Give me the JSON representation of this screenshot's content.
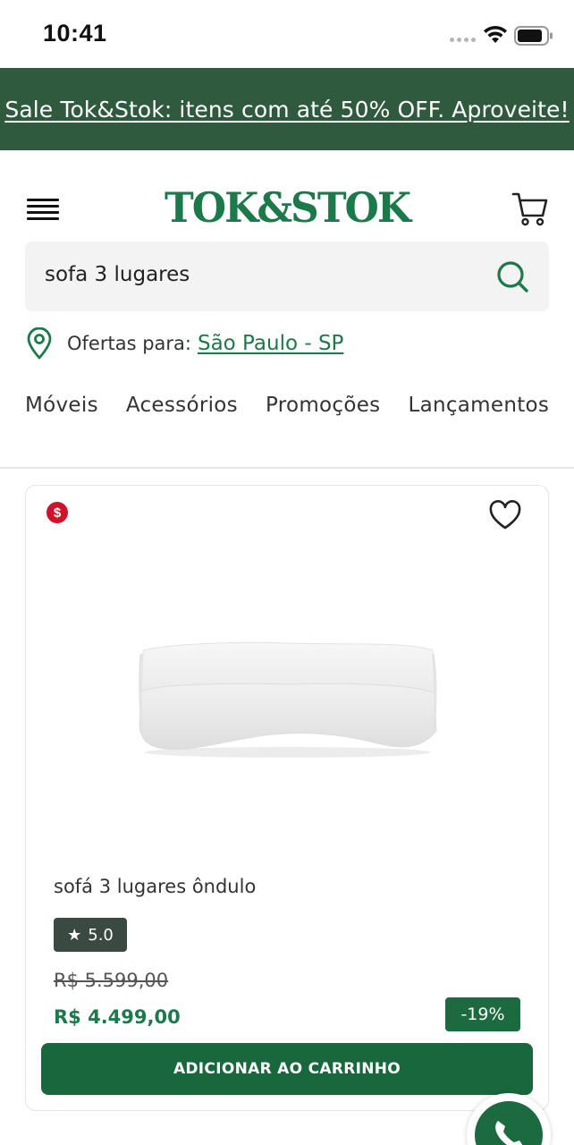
{
  "status_bar": {
    "time": "10:41"
  },
  "promo_banner": {
    "text": "Sale Tok&Stok: itens com até 50% OFF. Aproveite!"
  },
  "header": {
    "logo": "TOK&STOK"
  },
  "search": {
    "value": "sofa 3 lugares"
  },
  "location": {
    "label": "Ofertas para:",
    "city": "São Paulo - SP"
  },
  "categories": [
    "Móveis",
    "Acessórios",
    "Promoções",
    "Lançamentos"
  ],
  "product": {
    "sale_badge": "$",
    "name": "sofá 3 lugares ôndulo",
    "rating": "5.0",
    "old_price": "R$ 5.599,00",
    "price": "R$ 4.499,00",
    "discount": "-19%",
    "add_to_cart_label": "ADICIONAR AO CARRINHO"
  },
  "colors": {
    "brand_green": "#1c7a4a",
    "banner_green": "#2f5a3e",
    "button_green": "#19673d",
    "sale_red": "#d0122b"
  },
  "icons": [
    "wifi-icon",
    "battery-icon",
    "menu-icon",
    "cart-icon",
    "search-icon",
    "pin-icon",
    "heart-icon",
    "star-icon",
    "whatsapp-icon"
  ]
}
